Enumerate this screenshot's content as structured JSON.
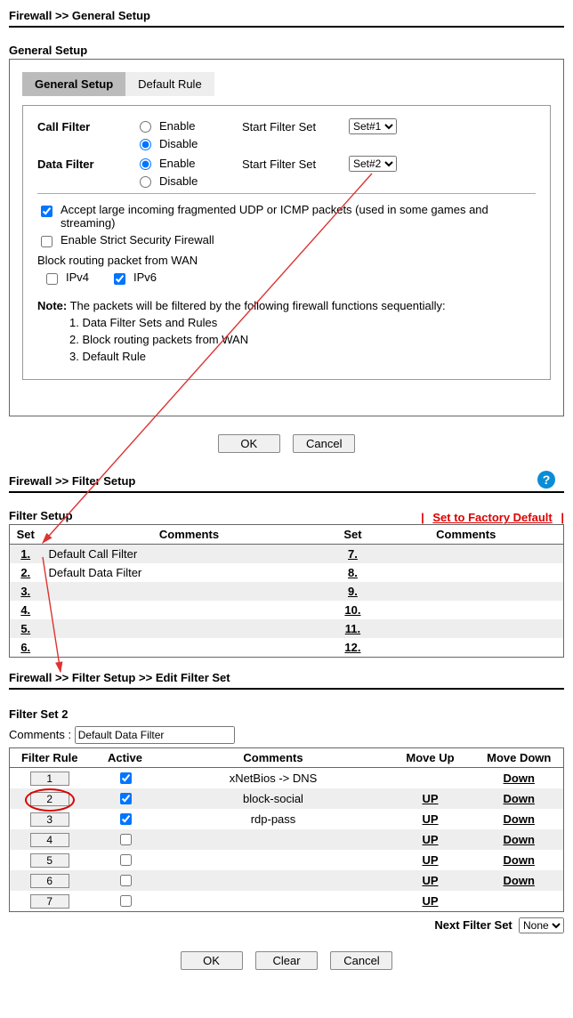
{
  "breadcrumb1": {
    "a": "Firewall",
    "sep": ">>",
    "b": "General Setup"
  },
  "general": {
    "section_title": "General Setup",
    "tabs": [
      "General Setup",
      "Default Rule"
    ],
    "call_filter_label": "Call Filter",
    "data_filter_label": "Data Filter",
    "enable": "Enable",
    "disable": "Disable",
    "start_filter_set": "Start Filter Set",
    "call_set": "Set#1",
    "data_set": "Set#2",
    "set_options": [
      "Set#1",
      "Set#2"
    ],
    "accept_udp": "Accept large incoming fragmented UDP or ICMP packets (used in some games and streaming)",
    "strict": "Enable Strict Security Firewall",
    "block_routing": "Block routing packet from WAN",
    "ipv4": "IPv4",
    "ipv6": "IPv6",
    "note_label": "Note:",
    "note_text": "The packets will be filtered by the following firewall functions sequentially:",
    "steps": [
      "1. Data Filter Sets and Rules",
      "2. Block routing packets from WAN",
      "3. Default Rule"
    ],
    "ok": "OK",
    "cancel": "Cancel"
  },
  "breadcrumb2": {
    "a": "Firewall",
    "sep": ">>",
    "b": "Filter Setup"
  },
  "filter_setup": {
    "title": "Filter Setup",
    "factory": "Set to Factory Default",
    "cols": [
      "Set",
      "Comments",
      "Set",
      "Comments"
    ],
    "rows": [
      {
        "n1": "1.",
        "c1": "Default Call Filter",
        "n2": "7.",
        "c2": ""
      },
      {
        "n1": "2.",
        "c1": "Default Data Filter",
        "n2": "8.",
        "c2": ""
      },
      {
        "n1": "3.",
        "c1": "",
        "n2": "9.",
        "c2": ""
      },
      {
        "n1": "4.",
        "c1": "",
        "n2": "10.",
        "c2": ""
      },
      {
        "n1": "5.",
        "c1": "",
        "n2": "11.",
        "c2": ""
      },
      {
        "n1": "6.",
        "c1": "",
        "n2": "12.",
        "c2": ""
      }
    ]
  },
  "breadcrumb3": {
    "a": "Firewall",
    "sep": ">>",
    "b": "Filter Setup",
    "c": "Edit Filter Set"
  },
  "edit": {
    "set_title": "Filter Set 2",
    "comments_label": "Comments :",
    "comments_value": "Default Data Filter",
    "cols": [
      "Filter Rule",
      "Active",
      "Comments",
      "Move Up",
      "Move Down"
    ],
    "rules": [
      {
        "n": "1",
        "active": true,
        "c": "xNetBios -> DNS",
        "up": "",
        "down": "Down"
      },
      {
        "n": "2",
        "active": true,
        "c": "block-social",
        "up": "UP",
        "down": "Down"
      },
      {
        "n": "3",
        "active": true,
        "c": "rdp-pass",
        "up": "UP",
        "down": "Down"
      },
      {
        "n": "4",
        "active": false,
        "c": "",
        "up": "UP",
        "down": "Down"
      },
      {
        "n": "5",
        "active": false,
        "c": "",
        "up": "UP",
        "down": "Down"
      },
      {
        "n": "6",
        "active": false,
        "c": "",
        "up": "UP",
        "down": "Down"
      },
      {
        "n": "7",
        "active": false,
        "c": "",
        "up": "UP",
        "down": ""
      }
    ],
    "next_label": "Next Filter Set",
    "next_value": "None",
    "next_options": [
      "None"
    ],
    "ok": "OK",
    "clear": "Clear",
    "cancel": "Cancel"
  }
}
